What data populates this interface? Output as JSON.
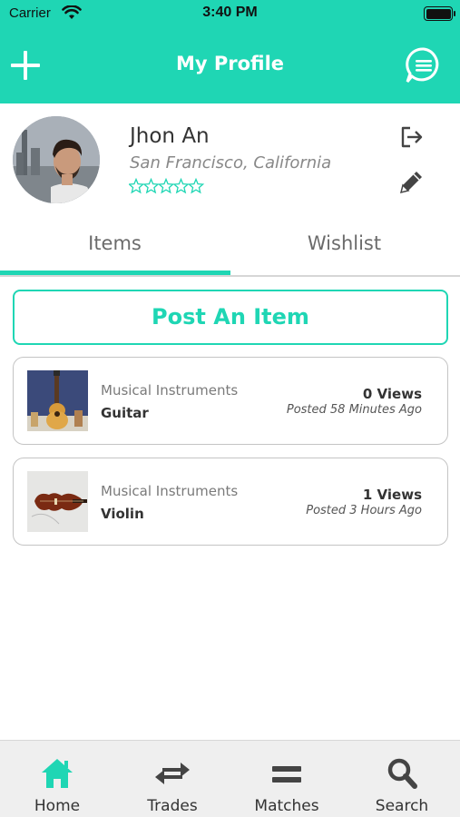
{
  "status_bar": {
    "carrier": "Carrier",
    "time": "3:40 PM"
  },
  "header": {
    "title": "My Profile"
  },
  "profile": {
    "name": "Jhon An",
    "location": "San Francisco, California",
    "rating": 0,
    "rating_max": 5
  },
  "tabs": [
    {
      "label": "Items",
      "active": true
    },
    {
      "label": "Wishlist",
      "active": false
    }
  ],
  "post_button": {
    "label": "Post An Item"
  },
  "items": [
    {
      "category": "Musical Instruments",
      "name": "Guitar",
      "views": "0 Views",
      "posted": "Posted 58 Minutes Ago",
      "image_icon": "guitar-photo"
    },
    {
      "category": "Musical Instruments",
      "name": "Violin",
      "views": "1 Views",
      "posted": "Posted 3 Hours Ago",
      "image_icon": "violin-photo"
    }
  ],
  "tabbar": [
    {
      "label": "Home",
      "icon": "home-icon",
      "active": true
    },
    {
      "label": "Trades",
      "icon": "trades-icon",
      "active": false
    },
    {
      "label": "Matches",
      "icon": "matches-icon",
      "active": false
    },
    {
      "label": "Search",
      "icon": "search-icon",
      "active": false
    }
  ],
  "colors": {
    "accent": "#1fd6b4",
    "text": "#333333",
    "muted": "#888888",
    "tabbar_bg": "#efefef"
  }
}
